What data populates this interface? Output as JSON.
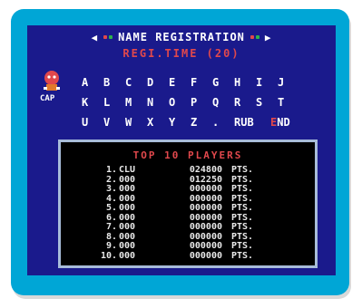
{
  "header": {
    "title": "NAME  REGISTRATION",
    "left_arrow": "◀",
    "right_arrow": "▶",
    "dot_colors": [
      "#e0484c",
      "#2db34a",
      "#ffffff"
    ]
  },
  "timer": "REGI.TIME  (20)",
  "logo": {
    "text": "CAP",
    "icon": "character-logo-icon"
  },
  "alphabet": {
    "row1": [
      "A",
      "B",
      "C",
      "D",
      "E",
      "F",
      "G",
      "H",
      "I",
      "J"
    ],
    "row2": [
      "K",
      "L",
      "M",
      "N",
      "O",
      "P",
      "Q",
      "R",
      "S",
      "T"
    ],
    "row3": [
      "U",
      "V",
      "W",
      "X",
      "Y",
      "Z",
      "."
    ],
    "rub_label": "RUB",
    "end_label_cursor": "E",
    "end_label_rest": "ND"
  },
  "leaderboard": {
    "title": "TOP 10 PLAYERS",
    "unit": "PTS.",
    "entries": [
      {
        "rank": "1.",
        "name": "CLU",
        "score": "024800"
      },
      {
        "rank": "2.",
        "name": "000",
        "score": "012250"
      },
      {
        "rank": "3.",
        "name": "000",
        "score": "000000"
      },
      {
        "rank": "4.",
        "name": "000",
        "score": "000000"
      },
      {
        "rank": "5.",
        "name": "000",
        "score": "000000"
      },
      {
        "rank": "6.",
        "name": "000",
        "score": "000000"
      },
      {
        "rank": "7.",
        "name": "000",
        "score": "000000"
      },
      {
        "rank": "8.",
        "name": "000",
        "score": "000000"
      },
      {
        "rank": "9.",
        "name": "000",
        "score": "000000"
      },
      {
        "rank": "10.",
        "name": "000",
        "score": "000000"
      }
    ]
  },
  "colors": {
    "screen_bg": "#1a1a8c",
    "frame": "#00a6d6",
    "accent_red": "#e0484c",
    "board_border": "#a7bcd9"
  }
}
